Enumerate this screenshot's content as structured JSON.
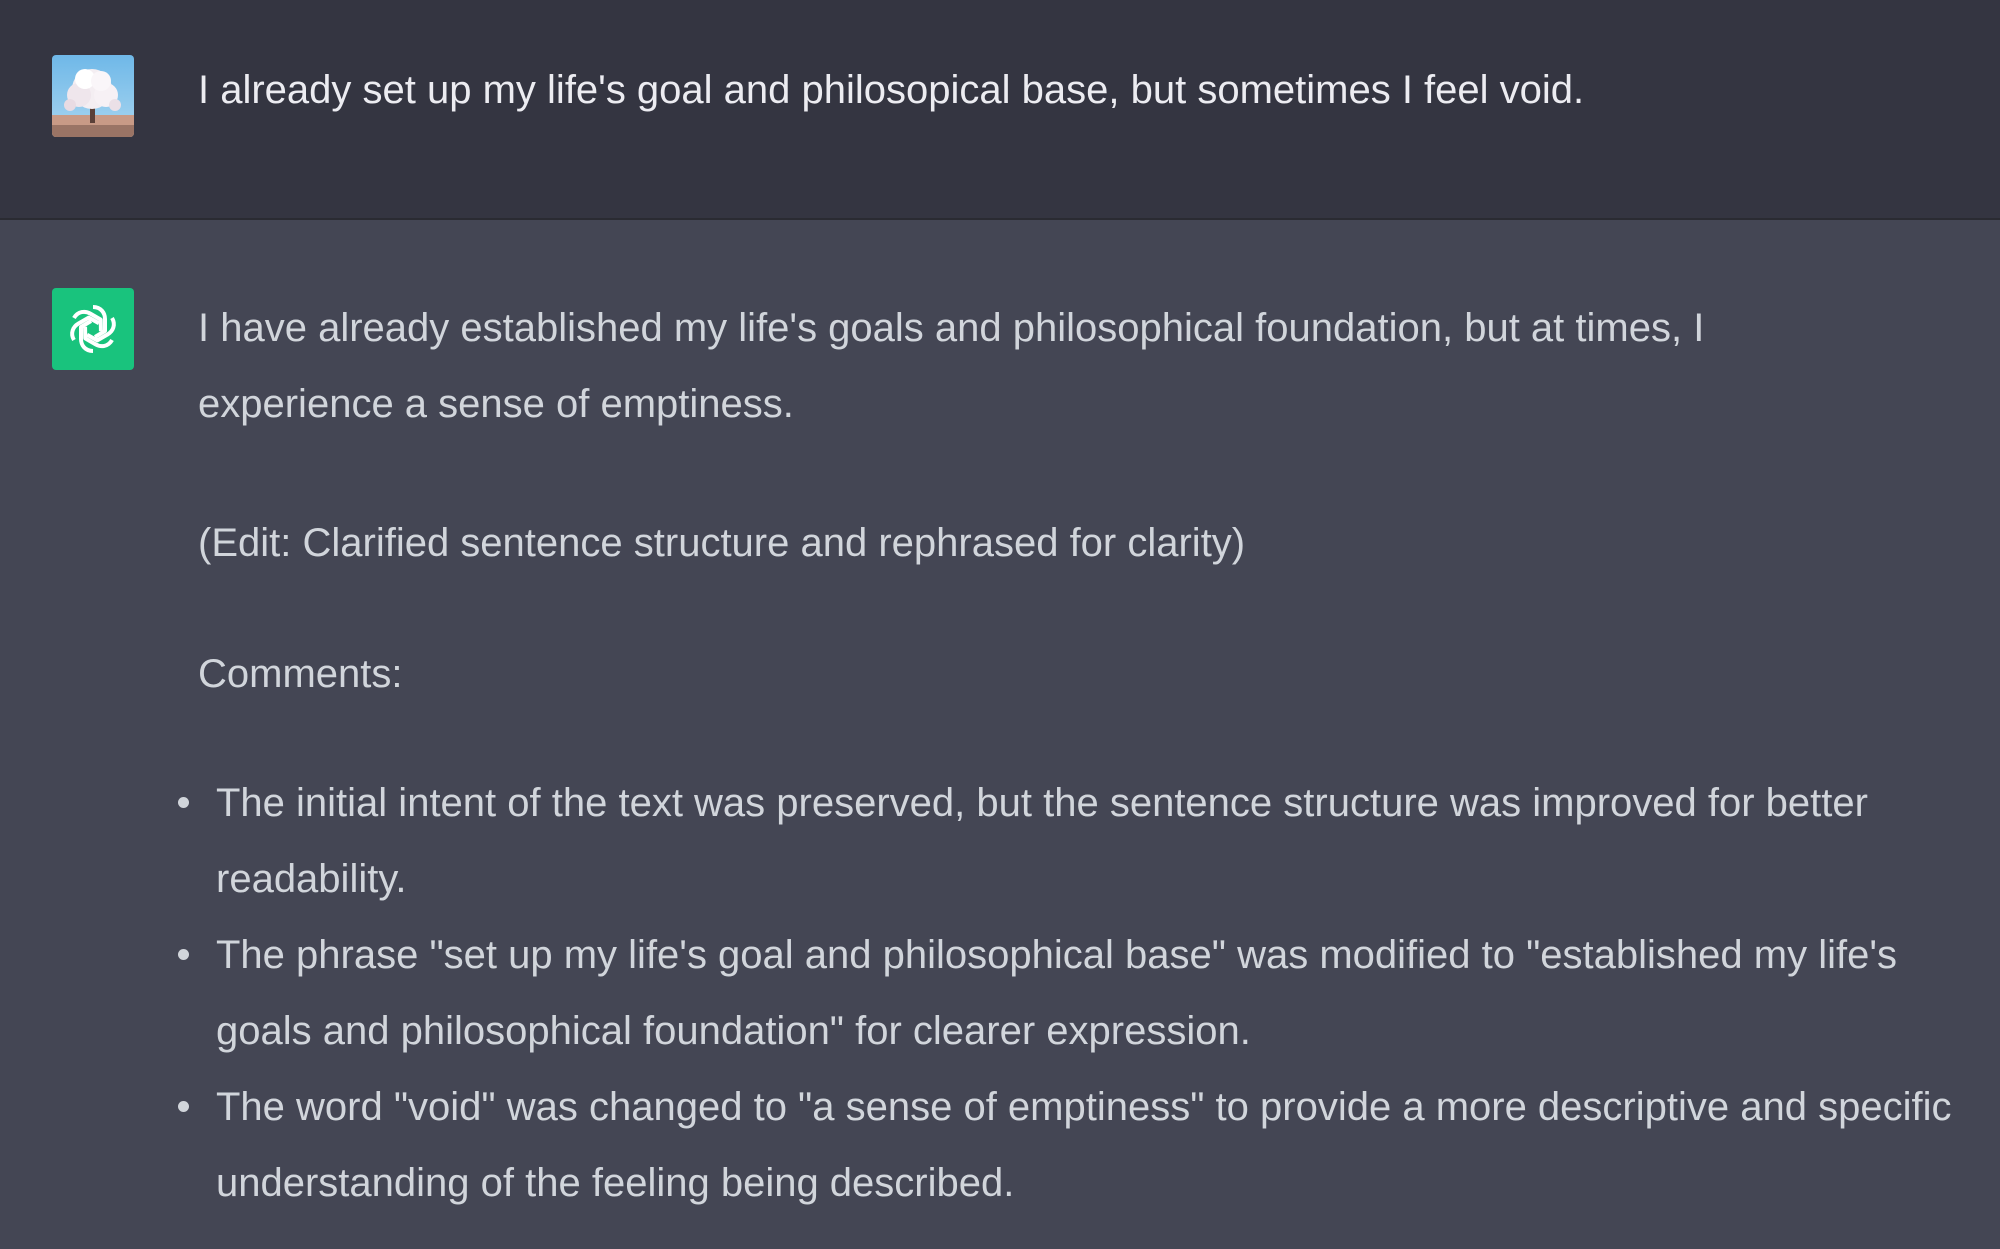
{
  "user_message": {
    "avatar": "cherry-blossom-tree-photo",
    "text": "I already set up my life's goal and philosopical base, but sometimes I feel void."
  },
  "assistant_message": {
    "avatar": "chatgpt-logo-icon",
    "paragraphs": [
      "I have already established my life's goals and philosophical foundation, but at times, I experience a sense of emptiness.",
      "(Edit: Clarified sentence structure and rephrased for clarity)",
      "Comments:"
    ],
    "bullets": [
      "The initial intent of the text was preserved, but the sentence structure was improved for better readability.",
      "The phrase \"set up my life's goal and philosophical base\" was modified to \"established my life's goals and philosophical foundation\" for clearer expression.",
      "The word \"void\" was changed to \"a sense of emptiness\" to provide a more descriptive and specific understanding of the feeling being described."
    ]
  },
  "colors": {
    "user_bg": "#343541",
    "assistant_bg": "#444654",
    "bot_avatar_bg": "#19c37d",
    "text": "#d1d5db"
  }
}
